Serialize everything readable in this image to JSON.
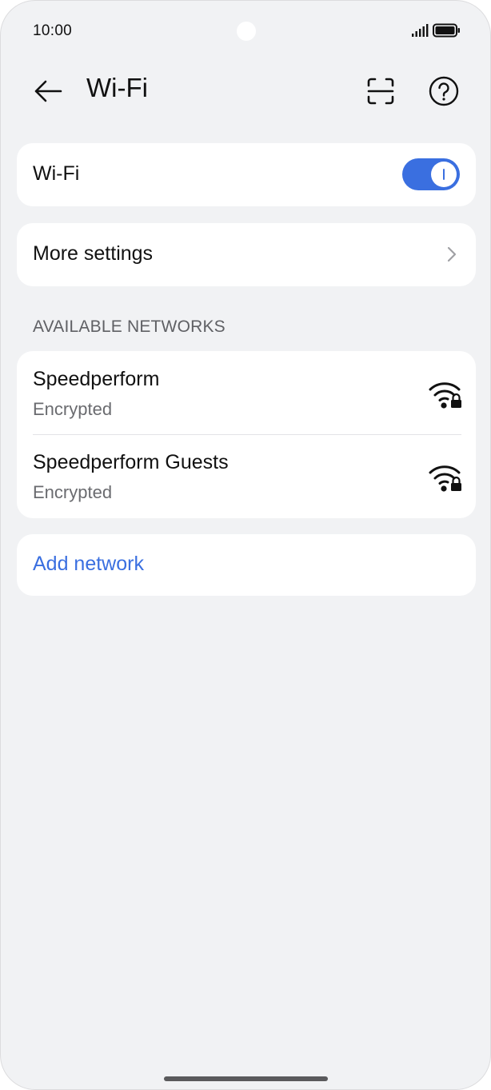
{
  "status_bar": {
    "time": "10:00",
    "icons": [
      "signal-icon",
      "battery-icon"
    ]
  },
  "header": {
    "title": "Wi-Fi",
    "icons": [
      "back-arrow-icon",
      "scan-icon",
      "help-icon"
    ]
  },
  "wifi_toggle": {
    "label": "Wi-Fi",
    "enabled": true
  },
  "more_settings": {
    "label": "More settings",
    "icon": "chevron-right-icon"
  },
  "available_networks": {
    "header": "AVAILABLE NETWORKS",
    "items": [
      {
        "name": "Speedperform",
        "status": "Encrypted",
        "icon": "wifi-lock-icon"
      },
      {
        "name": "Speedperform Guests",
        "status": "Encrypted",
        "icon": "wifi-lock-icon"
      }
    ]
  },
  "add_network": {
    "label": "Add network"
  },
  "colors": {
    "accent": "#3a6fe0",
    "background": "#f1f2f4",
    "card": "#ffffff",
    "text_primary": "#111111",
    "text_secondary": "#6a6b6f"
  }
}
